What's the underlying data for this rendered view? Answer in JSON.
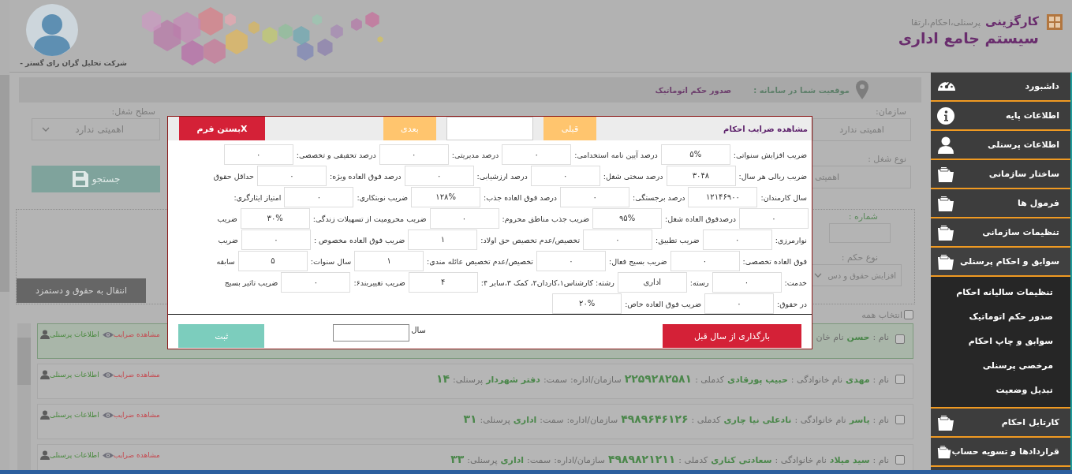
{
  "header": {
    "company_caption": "شرکت تحلیل گران رای گستر -",
    "app_name": "کارگزینی",
    "app_subtitle": "پرسنلی،احکام،ارتقا",
    "system_title": "سیستم جامع اداری"
  },
  "breadcrumb": {
    "label": "موقعیت شما در سامانه :",
    "current": "صدور حکم اتوماتیک"
  },
  "filters": {
    "organization": {
      "label": "سازمان:",
      "value": "اهمیتی ندارد"
    },
    "job_type": {
      "label": "نوع شغل :",
      "value": "اهمیتی"
    },
    "job_level": {
      "label": "سطح شغل:",
      "value": "اهمیتی ندارد"
    },
    "search_button": "جستجو",
    "number": {
      "label": "شماره :"
    },
    "decree_type": {
      "label": "نوع حکم :",
      "value": "افزایش حقوق و دس"
    },
    "transfer_button": "انتقال به حقوق و دستمزد"
  },
  "select_all": {
    "label": "انتخاب همه",
    "checked": false
  },
  "employees": [
    {
      "selected": true,
      "checked": false,
      "fields": [
        {
          "kind": "label",
          "text": "نام :"
        },
        {
          "kind": "value",
          "text": "حسن"
        },
        {
          "kind": "label",
          "text": "نام خان"
        }
      ],
      "actions": [
        {
          "kind": "coefficients",
          "text": "مشاهده ضرایب"
        },
        {
          "kind": "personnel",
          "text": "اطلاعات پرسنلی"
        }
      ]
    },
    {
      "selected": false,
      "checked": false,
      "fields": [
        {
          "kind": "label",
          "text": "نام :"
        },
        {
          "kind": "value",
          "text": "مهدی"
        },
        {
          "kind": "label",
          "text": "نام خانوادگی :"
        },
        {
          "kind": "value",
          "text": "حبیب پورقادی"
        },
        {
          "kind": "label",
          "text": "کدملی :"
        },
        {
          "kind": "code",
          "text": "۲۲۵۹۲۸۲۵۸۱"
        },
        {
          "kind": "label",
          "text": "سازمان/اداره:"
        },
        {
          "kind": "label",
          "text": "سمت:"
        },
        {
          "kind": "value",
          "text": "دفتر شهردار"
        },
        {
          "kind": "label",
          "text": "پرسنلی:"
        },
        {
          "kind": "code",
          "text": "۱۴"
        }
      ],
      "actions": [
        {
          "kind": "coefficients",
          "text": "مشاهده ضرایب"
        },
        {
          "kind": "personnel",
          "text": "اطلاعات پرسنلی"
        }
      ]
    },
    {
      "selected": false,
      "checked": false,
      "fields": [
        {
          "kind": "label",
          "text": "نام :"
        },
        {
          "kind": "value",
          "text": "یاسر"
        },
        {
          "kind": "label",
          "text": "نام خانوادگی :"
        },
        {
          "kind": "value",
          "text": "نادعلی نیا چاری"
        },
        {
          "kind": "label",
          "text": "کدملی :"
        },
        {
          "kind": "code",
          "text": "۴۹۸۹۶۴۶۱۲۶"
        },
        {
          "kind": "label",
          "text": "سازمان/اداره:"
        },
        {
          "kind": "label",
          "text": "سمت:"
        },
        {
          "kind": "value",
          "text": "اداری"
        },
        {
          "kind": "label",
          "text": "پرسنلی:"
        },
        {
          "kind": "code",
          "text": "۳۱"
        }
      ],
      "actions": [
        {
          "kind": "coefficients",
          "text": "مشاهده ضرایب"
        },
        {
          "kind": "personnel",
          "text": "اطلاعات پرسنلی"
        }
      ]
    },
    {
      "selected": false,
      "checked": false,
      "fields": [
        {
          "kind": "label",
          "text": "نام :"
        },
        {
          "kind": "value",
          "text": "سید میلاد"
        },
        {
          "kind": "label",
          "text": "نام خانوادگی :"
        },
        {
          "kind": "value",
          "text": "سعادتی کناری"
        },
        {
          "kind": "label",
          "text": "کدملی :"
        },
        {
          "kind": "code",
          "text": "۴۹۸۹۸۲۱۲۱۱"
        },
        {
          "kind": "label",
          "text": "سازمان/اداره:"
        },
        {
          "kind": "label",
          "text": "سمت:"
        },
        {
          "kind": "value",
          "text": "اداری"
        },
        {
          "kind": "label",
          "text": "پرسنلی:"
        },
        {
          "kind": "code",
          "text": "۳۳"
        }
      ],
      "actions": [
        {
          "kind": "coefficients",
          "text": "مشاهده ضرایب"
        },
        {
          "kind": "personnel",
          "text": "اطلاعات پرسنلی"
        }
      ]
    }
  ],
  "modal": {
    "title": "مشاهده ضرایب احکام",
    "prev_button": "قبلی",
    "next_button": "بعدی",
    "close_button": "Xبستن فرم",
    "lines": [
      {
        "items": [
          {
            "kind": "label",
            "text": "ضریب افزایش سنواتی:"
          },
          {
            "kind": "value",
            "text": "۵%"
          },
          {
            "kind": "label",
            "text": "درصد آیین نامه استخدامی:"
          },
          {
            "kind": "value",
            "text": "۰"
          },
          {
            "kind": "label",
            "text": "درصد مدیریتی:"
          },
          {
            "kind": "value",
            "text": "۰"
          },
          {
            "kind": "label",
            "text": "درصد تحقیقی و تخصصی:"
          },
          {
            "kind": "value",
            "text": "۰"
          }
        ]
      },
      {
        "items": [
          {
            "kind": "label",
            "text": "ضریب ریالی هر سال:"
          },
          {
            "kind": "value",
            "text": "۳۰۴۸"
          },
          {
            "kind": "label",
            "text": "درصد سختی شغل:"
          },
          {
            "kind": "value",
            "text": "۰"
          },
          {
            "kind": "label",
            "text": "درصد ارزشیابی:"
          },
          {
            "kind": "value",
            "text": "۰"
          },
          {
            "kind": "label",
            "text": "درصد فوق العاده ویژه:"
          },
          {
            "kind": "value",
            "text": "۰"
          },
          {
            "kind": "label",
            "text": "حداقل حقوق"
          }
        ]
      },
      {
        "items": [
          {
            "kind": "label",
            "text": "سال کارمندان:"
          },
          {
            "kind": "value",
            "text": "۱۲۱۴۶۹۰۰"
          },
          {
            "kind": "label",
            "text": "درصد برجستگی:"
          },
          {
            "kind": "value",
            "text": "۰"
          },
          {
            "kind": "label",
            "text": "درصد فوق العاده جذب:"
          },
          {
            "kind": "value",
            "text": "۱۲۸%"
          },
          {
            "kind": "label",
            "text": "ضریب نوبتکاری:"
          },
          {
            "kind": "value",
            "text": "۰"
          },
          {
            "kind": "label",
            "text": "امتیاز ایثارگری:"
          }
        ]
      },
      {
        "items": [
          {
            "kind": "value",
            "text": "۰"
          },
          {
            "kind": "label",
            "text": "درصدفوق العاده شغل:"
          },
          {
            "kind": "value",
            "text": "۹۵%"
          },
          {
            "kind": "label",
            "text": "ضریب جذب مناطق محروم:"
          },
          {
            "kind": "value",
            "text": "۰"
          },
          {
            "kind": "label",
            "text": "ضریب محرومیت از تسهیلات زندگی:"
          },
          {
            "kind": "value",
            "text": "۳۰%"
          },
          {
            "kind": "label",
            "text": "ضریب"
          }
        ]
      },
      {
        "items": [
          {
            "kind": "label",
            "text": "نوارمرزی:"
          },
          {
            "kind": "value",
            "text": "۰"
          },
          {
            "kind": "label",
            "text": "ضریب تطبیق:"
          },
          {
            "kind": "value",
            "text": "۰"
          },
          {
            "kind": "label",
            "text": "تخصیص/عدم تخصیص حق اولاد:"
          },
          {
            "kind": "value",
            "text": "۱"
          },
          {
            "kind": "label",
            "text": "ضریب فوق العاده مخصوص :"
          },
          {
            "kind": "value",
            "text": "۰"
          },
          {
            "kind": "label",
            "text": "ضریب"
          }
        ]
      },
      {
        "items": [
          {
            "kind": "label",
            "text": "فوق العاده تخصصی:"
          },
          {
            "kind": "value",
            "text": "۰"
          },
          {
            "kind": "label",
            "text": "ضریب بسیج فعال:"
          },
          {
            "kind": "value",
            "text": "۰"
          },
          {
            "kind": "label",
            "text": "تخصیص/عدم تخصیص عائله مندی:"
          },
          {
            "kind": "value",
            "text": "۱"
          },
          {
            "kind": "label",
            "text": "سال سنوات:"
          },
          {
            "kind": "value",
            "text": "۵"
          },
          {
            "kind": "label",
            "text": "سابقه"
          }
        ]
      },
      {
        "items": [
          {
            "kind": "label",
            "text": "خدمت:"
          },
          {
            "kind": "value",
            "text": "۰"
          },
          {
            "kind": "label",
            "text": "رسته:"
          },
          {
            "kind": "value",
            "text": "اداری"
          },
          {
            "kind": "label",
            "text": "رشته: کارشناس۱،کاردان۲، کمک ۳،سایر ۴:"
          },
          {
            "kind": "value",
            "text": "۴"
          },
          {
            "kind": "label",
            "text": "ضریب تغییربند۶:"
          },
          {
            "kind": "value",
            "text": "۰"
          },
          {
            "kind": "label",
            "text": "ضریب تاثیر بسیج"
          }
        ]
      },
      {
        "items": [
          {
            "kind": "label",
            "text": "در حقوق:"
          },
          {
            "kind": "value",
            "text": "۰"
          },
          {
            "kind": "label",
            "text": "ضریب فوق العاده خاص:"
          },
          {
            "kind": "value",
            "text": "۲۰%"
          }
        ]
      }
    ],
    "load_button": "بارگذاری از سال قبل",
    "year_label": "سال",
    "submit_button": "ثبت"
  },
  "sidebar": {
    "items": [
      {
        "kind": "gauge",
        "label": "داشبورد"
      },
      {
        "kind": "info",
        "label": "اطلاعات پایه"
      },
      {
        "kind": "person",
        "label": "اطلاعات پرسنلی"
      },
      {
        "kind": "folder",
        "label": "ساختار سازمانی"
      },
      {
        "kind": "folder",
        "label": "فرمول ها"
      },
      {
        "kind": "folder",
        "label": "تنظیمات سازمانی"
      },
      {
        "kind": "folder",
        "label": "سوابق و احکام پرسنلی",
        "expanded": true,
        "children": [
          {
            "label": "تنظیمات سالیانه احکام"
          },
          {
            "label": "صدور حکم اتوماتیک"
          },
          {
            "label": "سوابق و چاپ احکام"
          },
          {
            "label": "مرخصی پرسنلی"
          },
          {
            "label": "تبدیل وضعیت"
          }
        ]
      },
      {
        "kind": "folder",
        "label": "کارتابل احکام"
      },
      {
        "kind": "folder",
        "label": "قراردادها و تسویه حساب"
      }
    ]
  }
}
